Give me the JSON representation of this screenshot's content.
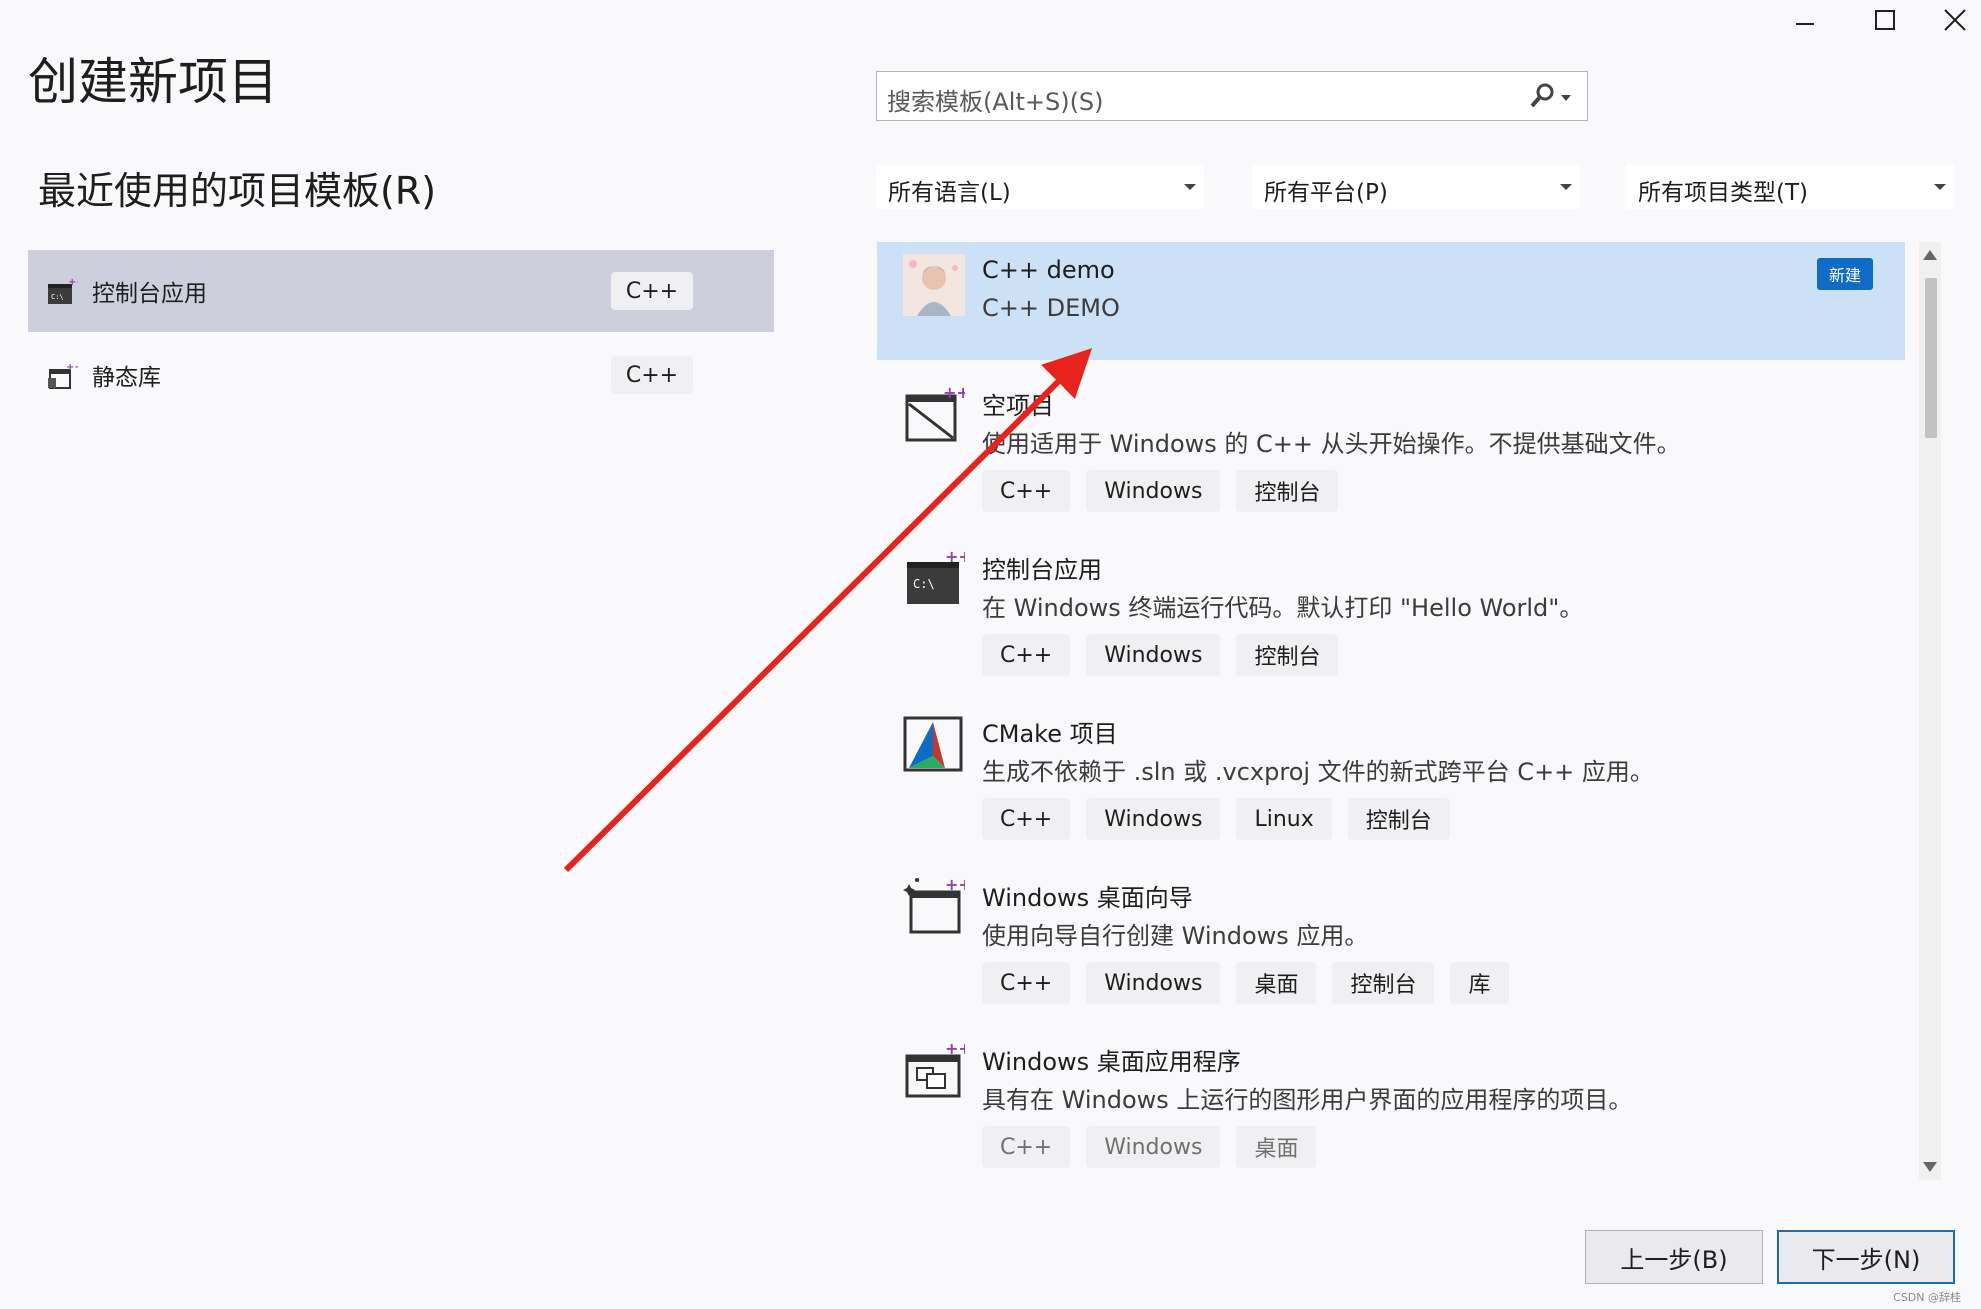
{
  "window": {
    "title": "创建新项目",
    "controls": [
      "minimize-icon",
      "maximize-icon",
      "close-icon"
    ]
  },
  "recent": {
    "heading": "最近使用的项目模板(R)",
    "items": [
      {
        "label": "控制台应用",
        "tag": "C++",
        "selected": true,
        "icon": "console-app-icon"
      },
      {
        "label": "静态库",
        "tag": "C++",
        "selected": false,
        "icon": "static-library-icon"
      }
    ]
  },
  "search": {
    "placeholder": "搜索模板(Alt+S)(S)"
  },
  "filters": {
    "language": "所有语言(L)",
    "platform": "所有平台(P)",
    "project_type": "所有项目类型(T)"
  },
  "templates": [
    {
      "name": "C++ demo",
      "desc": "C++ DEMO",
      "badge": "新建",
      "tags": [],
      "selected": true,
      "icon": "user-avatar-icon"
    },
    {
      "name": "空项目",
      "desc": "使用适用于 Windows 的 C++ 从头开始操作。不提供基础文件。",
      "tags": [
        "C++",
        "Windows",
        "控制台"
      ],
      "icon": "empty-project-icon"
    },
    {
      "name": "控制台应用",
      "desc": "在 Windows 终端运行代码。默认打印 \"Hello World\"。",
      "tags": [
        "C++",
        "Windows",
        "控制台"
      ],
      "icon": "console-app-icon"
    },
    {
      "name": "CMake 项目",
      "desc": "生成不依赖于 .sln 或 .vcxproj 文件的新式跨平台 C++ 应用。",
      "tags": [
        "C++",
        "Windows",
        "Linux",
        "控制台"
      ],
      "icon": "cmake-icon"
    },
    {
      "name": "Windows 桌面向导",
      "desc": "使用向导自行创建 Windows 应用。",
      "tags": [
        "C++",
        "Windows",
        "桌面",
        "控制台",
        "库"
      ],
      "icon": "desktop-wizard-icon"
    },
    {
      "name": "Windows 桌面应用程序",
      "desc": "具有在 Windows 上运行的图形用户界面的应用程序的项目。",
      "tags": [
        "C++",
        "Windows",
        "桌面"
      ],
      "icon": "desktop-app-icon"
    }
  ],
  "buttons": {
    "back": "上一步(B)",
    "next": "下一步(N)"
  },
  "watermark": "CSDN @辞桂",
  "colors": {
    "selection": "#cce0f6",
    "badge": "#0e6cc4",
    "arrow": "#e8231b"
  }
}
